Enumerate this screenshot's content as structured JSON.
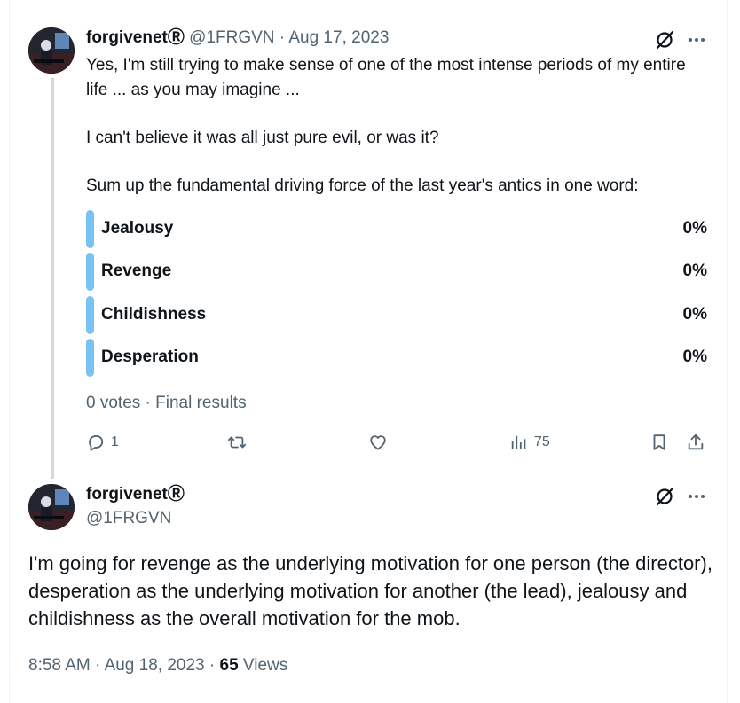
{
  "tweet": {
    "display_name": "forgivenetⓇ",
    "handle": "@1FRGVN",
    "separator": "·",
    "date": "Aug 17, 2023",
    "text_lines": [
      "Yes, I'm still trying to make sense of one of the most intense periods of my entire life ... as you may imagine ...",
      "I can't believe it was all just pure evil, or was it?",
      "Sum up the fundamental driving force of the last year's antics in one word:"
    ],
    "poll": {
      "options": [
        {
          "label": "Jealousy",
          "percent": "0%"
        },
        {
          "label": "Revenge",
          "percent": "0%"
        },
        {
          "label": "Childishness",
          "percent": "0%"
        },
        {
          "label": "Desperation",
          "percent": "0%"
        }
      ],
      "meta": "0 votes · Final results"
    },
    "actions": {
      "reply_count": "1",
      "views_count": "75"
    }
  },
  "reply": {
    "display_name": "forgivenetⓇ",
    "handle": "@1FRGVN",
    "text": "I'm going for revenge as the underlying motivation for one person (the director), desperation as the underlying motivation for another (the lead), jealousy and childishness as the overall motivation for the mob.",
    "time": "8:58 AM",
    "date": "Aug 18, 2023",
    "views_count": "65",
    "views_label": "Views"
  },
  "icons": {
    "grok": "grok-icon",
    "more": "more-icon",
    "reply": "reply-icon",
    "retweet": "retweet-icon",
    "like": "like-icon",
    "views": "views-icon",
    "bookmark": "bookmark-icon",
    "share": "share-icon"
  },
  "colors": {
    "poll_bar": "#79c3f4",
    "text_primary": "#0f1419",
    "text_secondary": "#536471",
    "thread_line": "#cfd9de"
  }
}
